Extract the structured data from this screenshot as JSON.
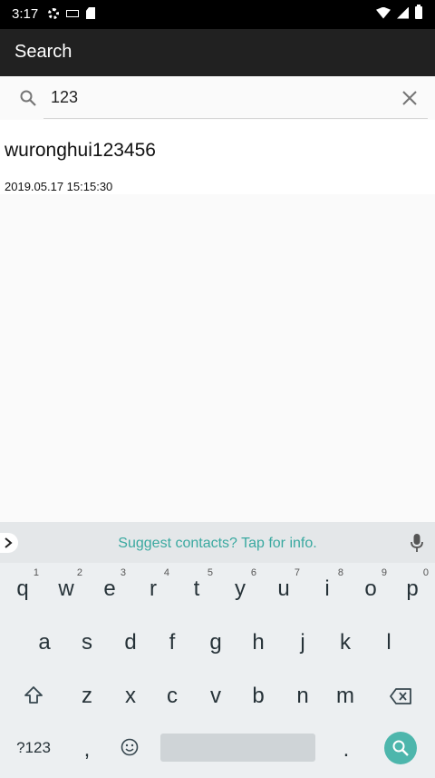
{
  "status": {
    "time": "3:17",
    "icons_left": [
      "settings-icon",
      "keyboard-icon",
      "sd-card-icon"
    ],
    "icons_right": [
      "wifi-icon",
      "signal-icon",
      "battery-icon"
    ]
  },
  "appbar": {
    "title": "Search"
  },
  "search": {
    "value": "123",
    "icon": "search-icon",
    "clear_icon": "close-icon"
  },
  "results": [
    {
      "title": "wuronghui123456",
      "time": "2019.05.17 15:15:30"
    }
  ],
  "keyboard": {
    "suggestion": "Suggest contacts? Tap for info.",
    "row1": [
      {
        "key": "q",
        "hint": "1"
      },
      {
        "key": "w",
        "hint": "2"
      },
      {
        "key": "e",
        "hint": "3"
      },
      {
        "key": "r",
        "hint": "4"
      },
      {
        "key": "t",
        "hint": "5"
      },
      {
        "key": "y",
        "hint": "6"
      },
      {
        "key": "u",
        "hint": "7"
      },
      {
        "key": "i",
        "hint": "8"
      },
      {
        "key": "o",
        "hint": "9"
      },
      {
        "key": "p",
        "hint": "0"
      }
    ],
    "row2": [
      "a",
      "s",
      "d",
      "f",
      "g",
      "h",
      "j",
      "k",
      "l"
    ],
    "row3": [
      "z",
      "x",
      "c",
      "v",
      "b",
      "n",
      "m"
    ],
    "symbols_label": "?123",
    "comma": ",",
    "period": ".",
    "accent_color": "#4db6ac"
  }
}
